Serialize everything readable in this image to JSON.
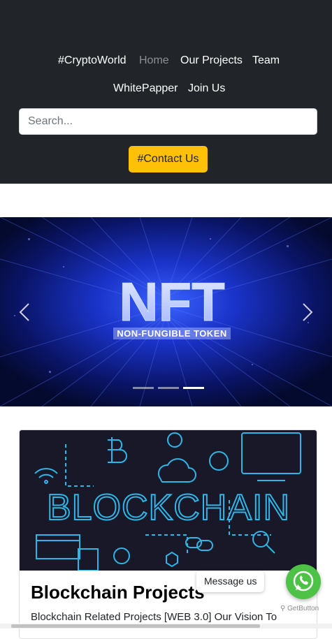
{
  "navbar": {
    "brand": "#CryptoWorld",
    "links": [
      "Home",
      "Our Projects",
      "Team",
      "WhitePapper",
      "Join Us"
    ],
    "search_placeholder": "Search...",
    "search_value": "",
    "contact_label": "#Contact Us"
  },
  "carousel": {
    "slide_title": "NFT",
    "slide_subtitle": "NON-FUNGIBLE TOKEN",
    "indicator_count": 3,
    "active_index": 2,
    "prev_icon": "chevron-left-icon",
    "next_icon": "chevron-right-icon"
  },
  "card": {
    "image_text": "BLOCKCHAIN",
    "title": "Blockchain Projects",
    "text": "Blockchain Related Projects [WEB 3.0] Our Vision To"
  },
  "widget": {
    "message_label": "Message us",
    "icon": "whatsapp-icon",
    "powered_by": "GetButton"
  },
  "colors": {
    "navbar_bg": "#212529",
    "accent": "#ffc107",
    "whatsapp": "#4dc247",
    "blockchain_line": "#2fb6e8"
  }
}
